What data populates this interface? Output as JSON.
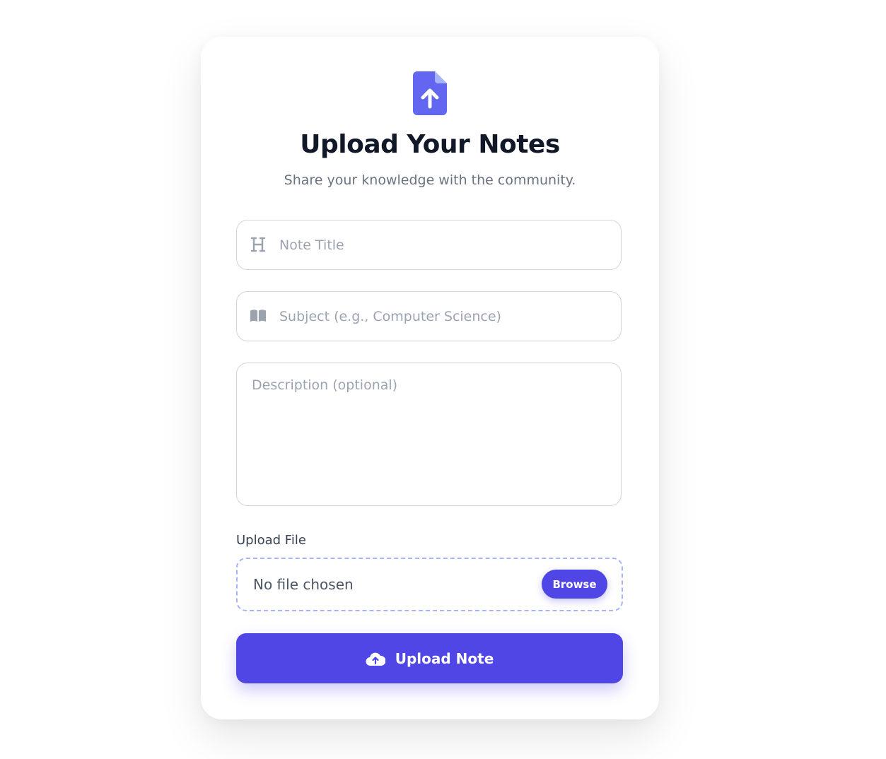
{
  "header": {
    "icon": "file-upload-icon",
    "title": "Upload Your Notes",
    "subtitle": "Share your knowledge with the community."
  },
  "form": {
    "title_field": {
      "icon": "heading-icon",
      "placeholder": "Note Title",
      "value": ""
    },
    "subject_field": {
      "icon": "book-icon",
      "placeholder": "Subject (e.g., Computer Science)",
      "value": ""
    },
    "description_field": {
      "placeholder": "Description (optional)",
      "value": ""
    },
    "upload": {
      "label": "Upload File",
      "status": "No file chosen",
      "browse_label": "Browse"
    },
    "submit": {
      "icon": "cloud-upload-icon",
      "label": "Upload Note"
    }
  },
  "colors": {
    "accent": "#4f46e5",
    "icon_accent": "#6366f1",
    "title": "#111827",
    "muted": "#6b7280",
    "placeholder": "#9ca3af",
    "dashed_border": "#a5b4fc"
  }
}
